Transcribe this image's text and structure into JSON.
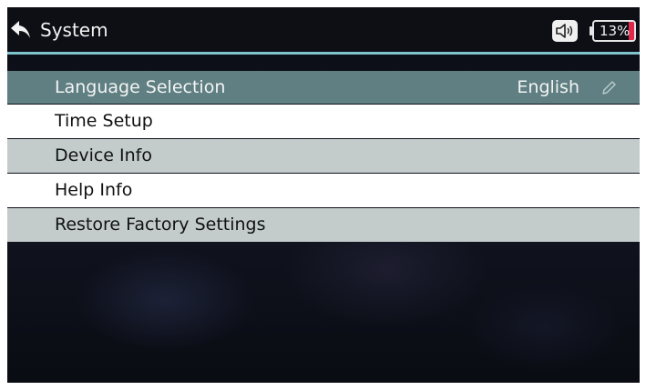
{
  "header": {
    "title": "System",
    "back_icon": "back-arrow-icon",
    "sound_icon": "speaker-icon",
    "battery_percent_label": "13%",
    "battery_level": 0.13
  },
  "colors": {
    "accent_line": "#7fc3cc",
    "selected_row": "#5f7f82",
    "alt_row": "#c3cbcb",
    "battery_fill": "#e0294a"
  },
  "menu": {
    "items": [
      {
        "label": "Language Selection",
        "value": "English",
        "selected": true
      },
      {
        "label": "Time Setup"
      },
      {
        "label": "Device Info"
      },
      {
        "label": "Help Info"
      },
      {
        "label": "Restore Factory Settings"
      }
    ]
  }
}
